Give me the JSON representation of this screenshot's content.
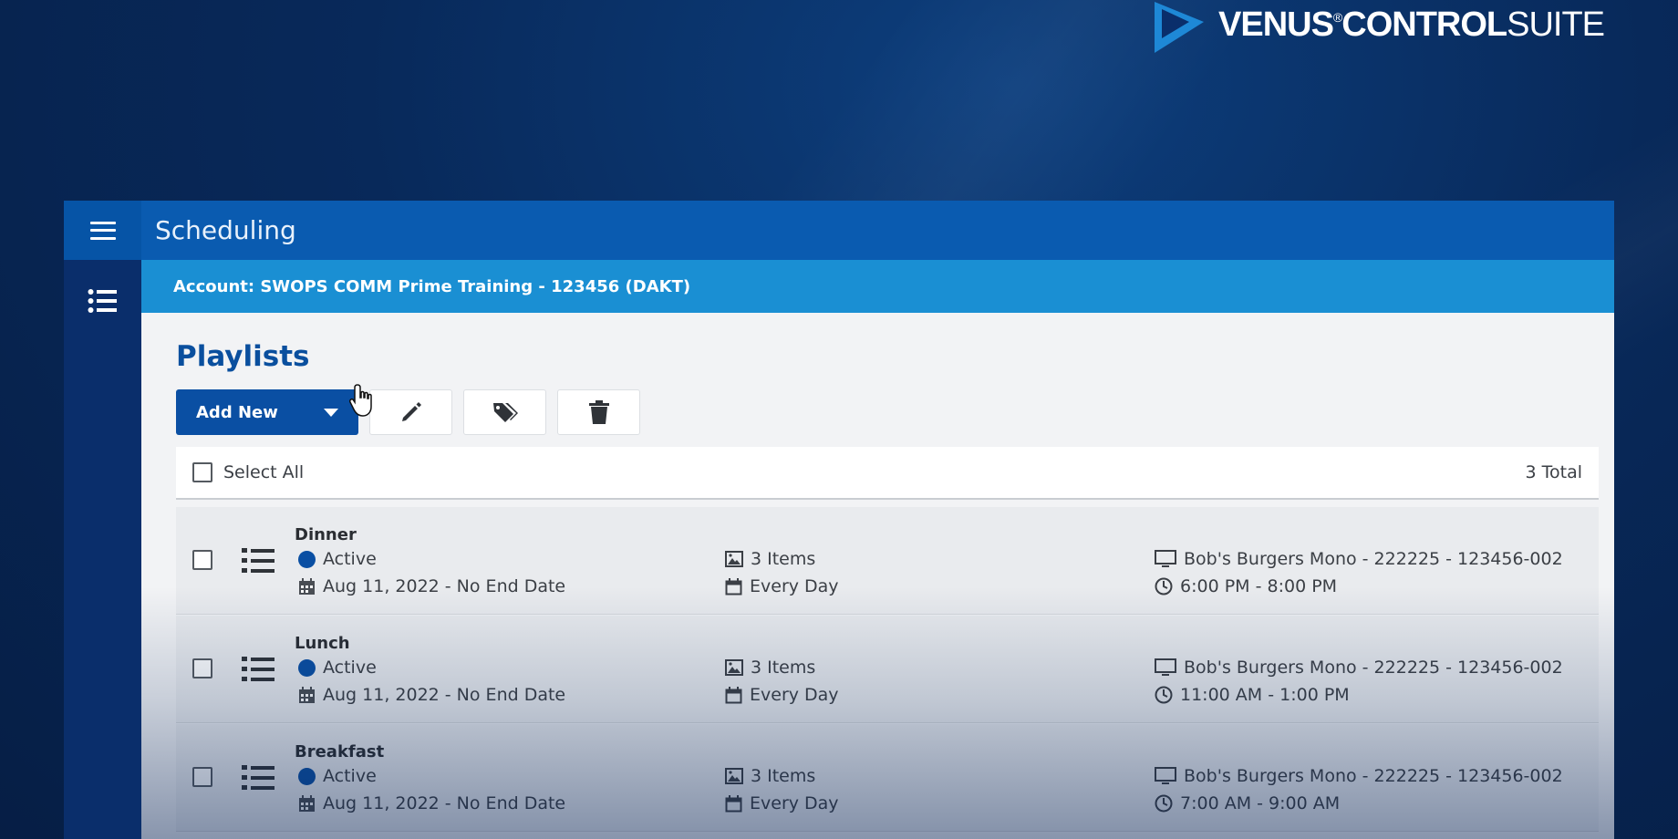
{
  "brand": {
    "name_bold": "VENUS",
    "mark": "®",
    "name_mid": "CONTROL",
    "name_light": "SUITE",
    "accent_color": "#1e88d6"
  },
  "header": {
    "title": "Scheduling",
    "account": "Account: SWOPS COMM Prime Training - 123456 (DAKT)"
  },
  "page": {
    "title": "Playlists",
    "add_new_label": "Add New",
    "toolbar_icons": [
      "pencil-icon",
      "tags-icon",
      "trash-icon"
    ]
  },
  "list": {
    "select_all_label": "Select All",
    "total_label": "3 Total",
    "rows": [
      {
        "name": "Dinner",
        "status": "Active",
        "dates": "Aug 11, 2022 - No End Date",
        "items": "3 Items",
        "recurrence": "Every Day",
        "display": "Bob's Burgers Mono - 222225 - 123456-002",
        "time": "6:00 PM - 8:00 PM"
      },
      {
        "name": "Lunch",
        "status": "Active",
        "dates": "Aug 11, 2022 - No End Date",
        "items": "3 Items",
        "recurrence": "Every Day",
        "display": "Bob's Burgers Mono - 222225 - 123456-002",
        "time": "11:00 AM - 1:00 PM"
      },
      {
        "name": "Breakfast",
        "status": "Active",
        "dates": "Aug 11, 2022 - No End Date",
        "items": "3 Items",
        "recurrence": "Every Day",
        "display": "Bob's Burgers Mono - 222225 - 123456-002",
        "time": "7:00 AM - 9:00 AM"
      }
    ]
  },
  "colors": {
    "primary": "#0a4fa3",
    "topbar": "#0a5bb0",
    "account_bar": "#1a8fd3",
    "status_active": "#0a4fa3"
  }
}
